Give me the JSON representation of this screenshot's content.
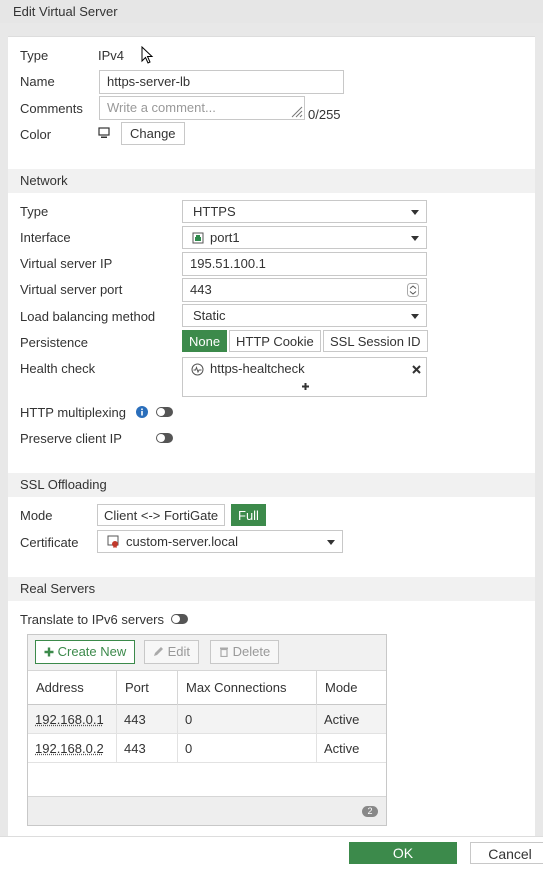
{
  "window": {
    "title": "Edit Virtual Server"
  },
  "general": {
    "type_label": "Type",
    "type_value": "IPv4",
    "name_label": "Name",
    "name_value": "https-server-lb",
    "comments_label": "Comments",
    "comments_placeholder": "Write a comment...",
    "comments_counter": "0/255",
    "color_label": "Color",
    "color_button": "Change"
  },
  "network": {
    "header": "Network",
    "type_label": "Type",
    "type_value": "HTTPS",
    "interface_label": "Interface",
    "interface_value": "port1",
    "vip_label": "Virtual server IP",
    "vip_value": "195.51.100.1",
    "vport_label": "Virtual server port",
    "vport_value": "443",
    "lb_label": "Load balancing method",
    "lb_value": "Static",
    "persistence_label": "Persistence",
    "persistence_options": [
      "None",
      "HTTP Cookie",
      "SSL Session ID"
    ],
    "persistence_selected": "None",
    "health_label": "Health check",
    "health_value": "https-healtcheck",
    "http_mux_label": "HTTP multiplexing",
    "preserve_ip_label": "Preserve client IP"
  },
  "ssl": {
    "header": "SSL Offloading",
    "mode_label": "Mode",
    "mode_options": [
      "Client <-> FortiGate",
      "Full"
    ],
    "mode_selected": "Full",
    "cert_label": "Certificate",
    "cert_value": "custom-server.local"
  },
  "real_servers": {
    "header": "Real Servers",
    "ipv6_label": "Translate to IPv6 servers",
    "toolbar": {
      "create": "Create New",
      "edit": "Edit",
      "delete": "Delete"
    },
    "columns": [
      "Address",
      "Port",
      "Max Connections",
      "Mode"
    ],
    "rows": [
      [
        "192.168.0.1",
        "443",
        "0",
        "Active"
      ],
      [
        "192.168.0.2",
        "443",
        "0",
        "Active"
      ]
    ],
    "count": "2"
  },
  "footer": {
    "ok": "OK",
    "cancel": "Cancel"
  },
  "colors": {
    "accent": "#3c8a4b",
    "section_bg": "#f1f1f1",
    "info_blue": "#2a6ebb"
  }
}
